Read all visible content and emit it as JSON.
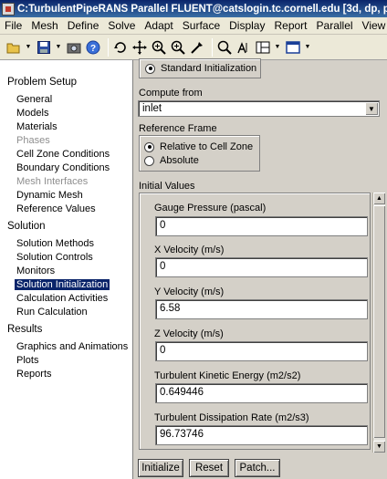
{
  "window": {
    "title": "C:TurbulentPipeRANS Parallel FLUENT@catslogin.tc.cornell.edu  [3d, dp, p"
  },
  "menubar": {
    "items": [
      "File",
      "Mesh",
      "Define",
      "Solve",
      "Adapt",
      "Surface",
      "Display",
      "Report",
      "Parallel",
      "View",
      "He"
    ]
  },
  "toolbar": {
    "buttons": [
      "open-folder-icon",
      "save-icon",
      "camera-icon",
      "help-icon",
      "rotate-icon",
      "pan-icon",
      "zoom-in-icon",
      "zoom-box-icon",
      "probe-icon",
      "fit-icon",
      "annotate-icon",
      "layout-icon",
      "window-icon"
    ]
  },
  "tree": {
    "problem_setup": {
      "label": "Problem Setup",
      "items": [
        {
          "label": "General",
          "enabled": true
        },
        {
          "label": "Models",
          "enabled": true
        },
        {
          "label": "Materials",
          "enabled": true
        },
        {
          "label": "Phases",
          "enabled": false
        },
        {
          "label": "Cell Zone Conditions",
          "enabled": true
        },
        {
          "label": "Boundary Conditions",
          "enabled": true
        },
        {
          "label": "Mesh Interfaces",
          "enabled": false
        },
        {
          "label": "Dynamic Mesh",
          "enabled": true
        },
        {
          "label": "Reference Values",
          "enabled": true
        }
      ]
    },
    "solution": {
      "label": "Solution",
      "items": [
        {
          "label": "Solution Methods",
          "selected": false
        },
        {
          "label": "Solution Controls",
          "selected": false
        },
        {
          "label": "Monitors",
          "selected": false
        },
        {
          "label": "Solution Initialization",
          "selected": true
        },
        {
          "label": "Calculation Activities",
          "selected": false
        },
        {
          "label": "Run Calculation",
          "selected": false
        }
      ]
    },
    "results": {
      "label": "Results",
      "items": [
        "Graphics and Animations",
        "Plots",
        "Reports"
      ]
    }
  },
  "panel": {
    "init_method": {
      "label": "Standard Initialization",
      "checked": true
    },
    "compute_from": {
      "label": "Compute from",
      "value": "inlet"
    },
    "reference_frame": {
      "label": "Reference Frame",
      "options": [
        {
          "label": "Relative to Cell Zone",
          "checked": true
        },
        {
          "label": "Absolute",
          "checked": false
        }
      ]
    },
    "initial_values": {
      "label": "Initial Values",
      "fields": [
        {
          "label": "Gauge Pressure (pascal)",
          "value": "0"
        },
        {
          "label": "X Velocity (m/s)",
          "value": "0"
        },
        {
          "label": "Y Velocity (m/s)",
          "value": "6.58"
        },
        {
          "label": "Z Velocity (m/s)",
          "value": "0"
        },
        {
          "label": "Turbulent Kinetic Energy (m2/s2)",
          "value": "0.649446"
        },
        {
          "label": "Turbulent Dissipation Rate (m2/s3)",
          "value": "96.73746"
        }
      ]
    },
    "buttons": {
      "initialize": "Initialize",
      "reset": "Reset",
      "patch": "Patch..."
    }
  }
}
